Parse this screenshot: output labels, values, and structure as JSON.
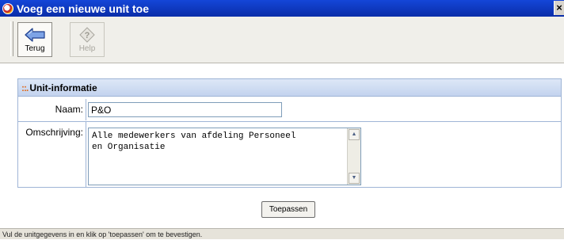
{
  "window": {
    "title": "Voeg een nieuwe unit toe",
    "close_label": "×"
  },
  "toolbar": {
    "back_label": "Terug",
    "back_icon": "arrow-left-icon",
    "help_label": "Help",
    "help_icon": "help-question-icon",
    "help_enabled": false
  },
  "form": {
    "section_title": "Unit-informatie",
    "section_marker": "::.",
    "name_label": "Naam:",
    "name_value": "P&O",
    "description_label": "Omschrijving:",
    "description_value": "Alle medewerkers van afdeling Personeel\nen Organisatie",
    "submit_label": "Toepassen"
  },
  "status": {
    "text": "Vul de unitgegevens in en klik op 'toepassen' om te bevestigen."
  },
  "colors": {
    "titlebar": "#0a2da8",
    "section_header": "#cfdcf2",
    "border": "#9fb5d6",
    "marker": "#e06a1a"
  }
}
